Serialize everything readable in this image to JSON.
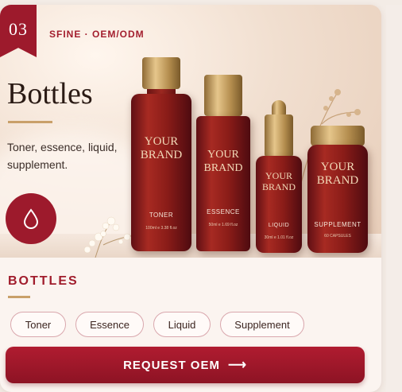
{
  "badge": {
    "number": "03"
  },
  "tagline": "SFINE · OEM/ODM",
  "hero": {
    "title": "Bottles",
    "description": "Toner, essence, liquid, supplement.",
    "icon": "water-drop-icon"
  },
  "bottles": [
    {
      "brand_line1": "YOUR",
      "brand_line2": "BRAND",
      "product": "TONER",
      "volume": "100ml e 3.38 fl.oz"
    },
    {
      "brand_line1": "YOUR",
      "brand_line2": "BRAND",
      "product": "ESSENCE",
      "volume": "50ml e 1.69 fl.oz"
    },
    {
      "brand_line1": "YOUR",
      "brand_line2": "BRAND",
      "product": "LIQUID",
      "volume": "30ml e 1.01 fl.oz"
    },
    {
      "brand_line1": "YOUR",
      "brand_line2": "BRAND",
      "product": "SUPPLEMENT",
      "volume": "60 CAPSULES"
    }
  ],
  "section": {
    "title": "BOTTLES"
  },
  "chips": [
    "Toner",
    "Essence",
    "Liquid",
    "Supplement"
  ],
  "cta": {
    "label": "REQUEST OEM",
    "icon": "arrow-right-icon"
  },
  "colors": {
    "accent": "#9d1a2c",
    "gold": "#c9a06a",
    "background": "#fbf4f0"
  }
}
